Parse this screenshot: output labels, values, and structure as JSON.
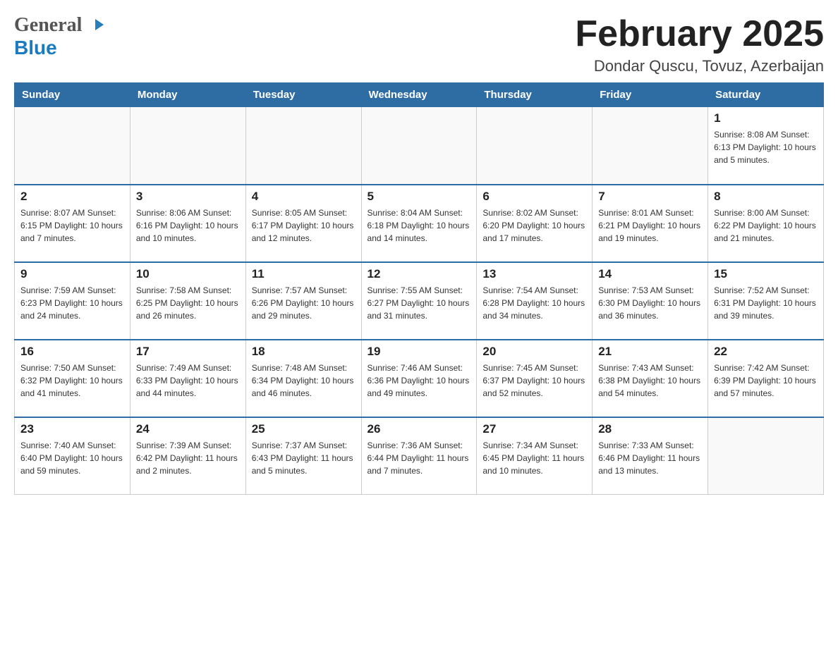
{
  "header": {
    "logo": {
      "general": "General",
      "blue": "Blue",
      "arrow_title": "GeneralBlue Logo"
    },
    "title": "February 2025",
    "subtitle": "Dondar Quscu, Tovuz, Azerbaijan"
  },
  "calendar": {
    "days_of_week": [
      "Sunday",
      "Monday",
      "Tuesday",
      "Wednesday",
      "Thursday",
      "Friday",
      "Saturday"
    ],
    "weeks": [
      {
        "days": [
          {
            "number": "",
            "info": ""
          },
          {
            "number": "",
            "info": ""
          },
          {
            "number": "",
            "info": ""
          },
          {
            "number": "",
            "info": ""
          },
          {
            "number": "",
            "info": ""
          },
          {
            "number": "",
            "info": ""
          },
          {
            "number": "1",
            "info": "Sunrise: 8:08 AM\nSunset: 6:13 PM\nDaylight: 10 hours and 5 minutes."
          }
        ]
      },
      {
        "days": [
          {
            "number": "2",
            "info": "Sunrise: 8:07 AM\nSunset: 6:15 PM\nDaylight: 10 hours and 7 minutes."
          },
          {
            "number": "3",
            "info": "Sunrise: 8:06 AM\nSunset: 6:16 PM\nDaylight: 10 hours and 10 minutes."
          },
          {
            "number": "4",
            "info": "Sunrise: 8:05 AM\nSunset: 6:17 PM\nDaylight: 10 hours and 12 minutes."
          },
          {
            "number": "5",
            "info": "Sunrise: 8:04 AM\nSunset: 6:18 PM\nDaylight: 10 hours and 14 minutes."
          },
          {
            "number": "6",
            "info": "Sunrise: 8:02 AM\nSunset: 6:20 PM\nDaylight: 10 hours and 17 minutes."
          },
          {
            "number": "7",
            "info": "Sunrise: 8:01 AM\nSunset: 6:21 PM\nDaylight: 10 hours and 19 minutes."
          },
          {
            "number": "8",
            "info": "Sunrise: 8:00 AM\nSunset: 6:22 PM\nDaylight: 10 hours and 21 minutes."
          }
        ]
      },
      {
        "days": [
          {
            "number": "9",
            "info": "Sunrise: 7:59 AM\nSunset: 6:23 PM\nDaylight: 10 hours and 24 minutes."
          },
          {
            "number": "10",
            "info": "Sunrise: 7:58 AM\nSunset: 6:25 PM\nDaylight: 10 hours and 26 minutes."
          },
          {
            "number": "11",
            "info": "Sunrise: 7:57 AM\nSunset: 6:26 PM\nDaylight: 10 hours and 29 minutes."
          },
          {
            "number": "12",
            "info": "Sunrise: 7:55 AM\nSunset: 6:27 PM\nDaylight: 10 hours and 31 minutes."
          },
          {
            "number": "13",
            "info": "Sunrise: 7:54 AM\nSunset: 6:28 PM\nDaylight: 10 hours and 34 minutes."
          },
          {
            "number": "14",
            "info": "Sunrise: 7:53 AM\nSunset: 6:30 PM\nDaylight: 10 hours and 36 minutes."
          },
          {
            "number": "15",
            "info": "Sunrise: 7:52 AM\nSunset: 6:31 PM\nDaylight: 10 hours and 39 minutes."
          }
        ]
      },
      {
        "days": [
          {
            "number": "16",
            "info": "Sunrise: 7:50 AM\nSunset: 6:32 PM\nDaylight: 10 hours and 41 minutes."
          },
          {
            "number": "17",
            "info": "Sunrise: 7:49 AM\nSunset: 6:33 PM\nDaylight: 10 hours and 44 minutes."
          },
          {
            "number": "18",
            "info": "Sunrise: 7:48 AM\nSunset: 6:34 PM\nDaylight: 10 hours and 46 minutes."
          },
          {
            "number": "19",
            "info": "Sunrise: 7:46 AM\nSunset: 6:36 PM\nDaylight: 10 hours and 49 minutes."
          },
          {
            "number": "20",
            "info": "Sunrise: 7:45 AM\nSunset: 6:37 PM\nDaylight: 10 hours and 52 minutes."
          },
          {
            "number": "21",
            "info": "Sunrise: 7:43 AM\nSunset: 6:38 PM\nDaylight: 10 hours and 54 minutes."
          },
          {
            "number": "22",
            "info": "Sunrise: 7:42 AM\nSunset: 6:39 PM\nDaylight: 10 hours and 57 minutes."
          }
        ]
      },
      {
        "days": [
          {
            "number": "23",
            "info": "Sunrise: 7:40 AM\nSunset: 6:40 PM\nDaylight: 10 hours and 59 minutes."
          },
          {
            "number": "24",
            "info": "Sunrise: 7:39 AM\nSunset: 6:42 PM\nDaylight: 11 hours and 2 minutes."
          },
          {
            "number": "25",
            "info": "Sunrise: 7:37 AM\nSunset: 6:43 PM\nDaylight: 11 hours and 5 minutes."
          },
          {
            "number": "26",
            "info": "Sunrise: 7:36 AM\nSunset: 6:44 PM\nDaylight: 11 hours and 7 minutes."
          },
          {
            "number": "27",
            "info": "Sunrise: 7:34 AM\nSunset: 6:45 PM\nDaylight: 11 hours and 10 minutes."
          },
          {
            "number": "28",
            "info": "Sunrise: 7:33 AM\nSunset: 6:46 PM\nDaylight: 11 hours and 13 minutes."
          },
          {
            "number": "",
            "info": ""
          }
        ]
      }
    ]
  }
}
